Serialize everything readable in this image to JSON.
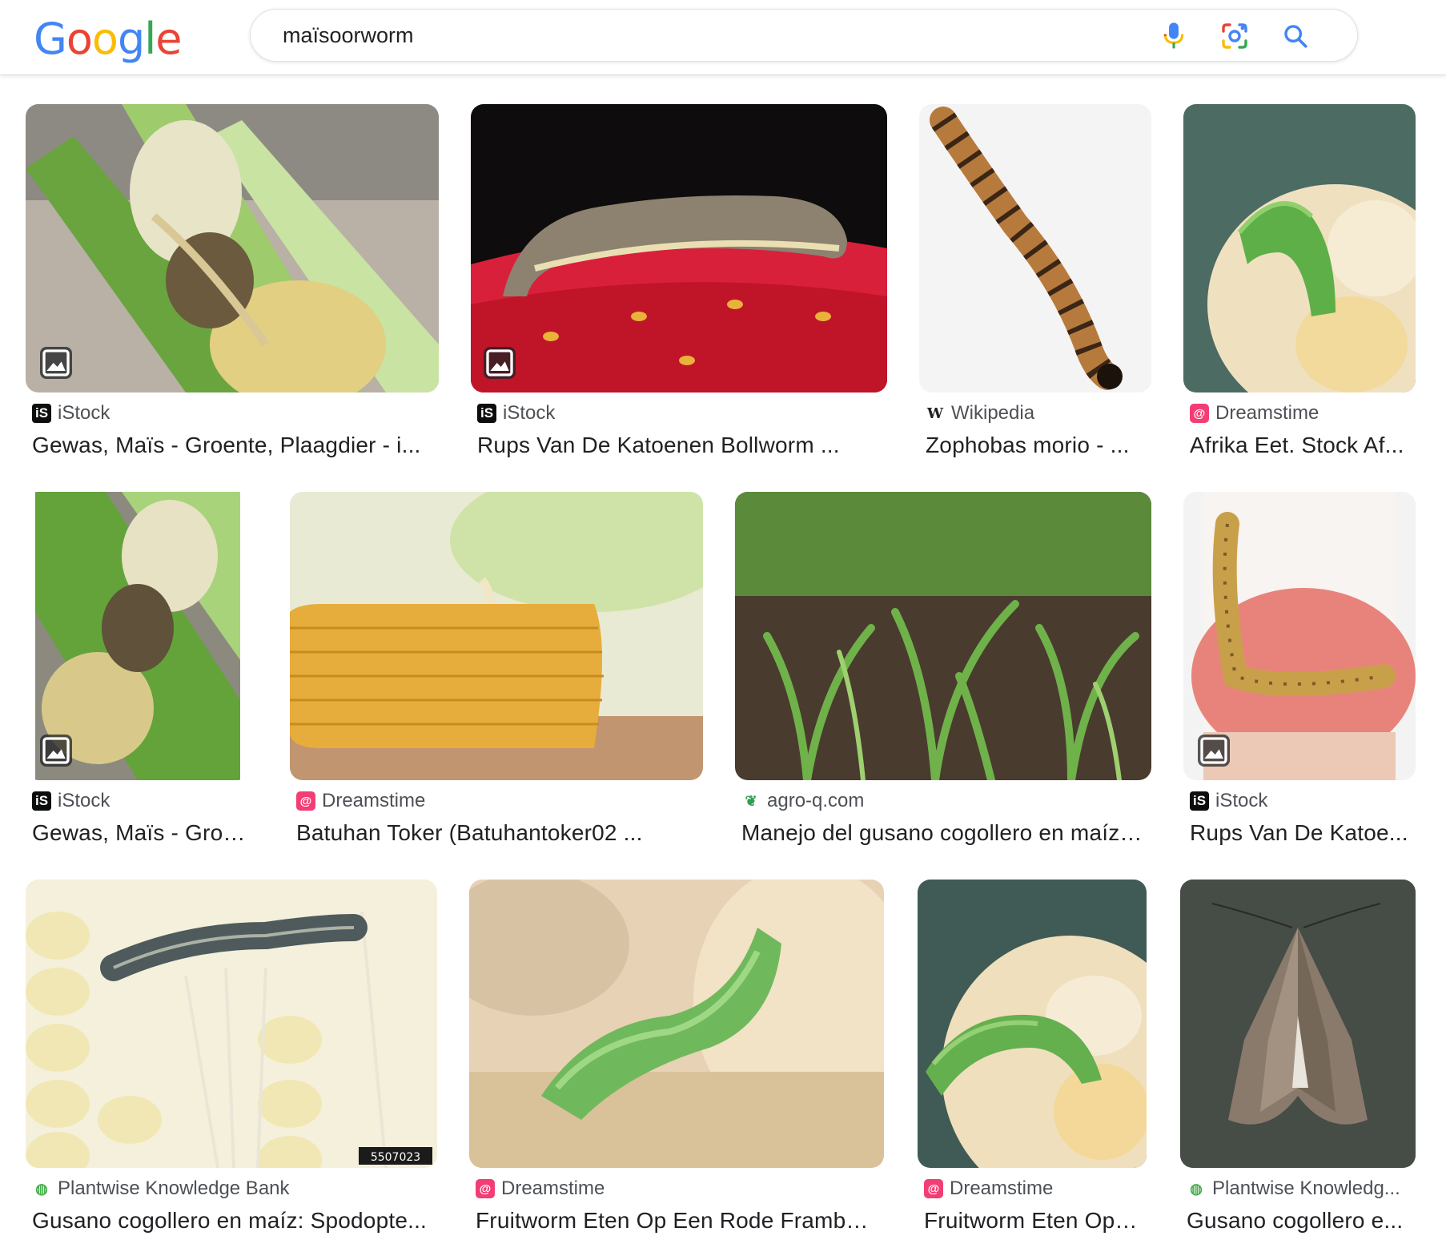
{
  "header": {
    "logo_letters": [
      "G",
      "o",
      "o",
      "g",
      "l",
      "e"
    ],
    "query": "maïsoorworm"
  },
  "colors": {
    "google_blue": "#4285F4",
    "google_red": "#EA4335",
    "google_yellow": "#FBBC05",
    "google_green": "#34A853"
  },
  "results": [
    {
      "source": "iStock",
      "title": "Gewas, Maïs - Groente, Plaagdier - i...",
      "favicon": "istock-favicon"
    },
    {
      "source": "iStock",
      "title": "Rups Van De Katoenen Bollworm ...",
      "favicon": "istock-favicon"
    },
    {
      "source": "Wikipedia",
      "title": "Zophobas morio - ...",
      "favicon": "wikipedia-favicon"
    },
    {
      "source": "Dreamstime",
      "title": "Afrika Eet. Stock Af...",
      "favicon": "dreamstime-favicon"
    },
    {
      "source": "iStock",
      "title": "Gewas, Maïs - Groe...",
      "favicon": "istock-favicon"
    },
    {
      "source": "Dreamstime",
      "title": "Batuhan Toker (Batuhantoker02 ...",
      "favicon": "dreamstime-favicon"
    },
    {
      "source": "agro-q.com",
      "title": "Manejo del gusano cogollero en maíz ...",
      "favicon": "agro-q-favicon"
    },
    {
      "source": "iStock",
      "title": "Rups Van De Katoe...",
      "favicon": "istock-favicon"
    },
    {
      "source": "Plantwise Knowledge Bank",
      "title": "Gusano cogollero en maíz: Spodopte...",
      "favicon": "plantwise-favicon"
    },
    {
      "source": "Dreamstime",
      "title": "Fruitworm Eten Op Een Rode Frambo...",
      "favicon": "dreamstime-favicon"
    },
    {
      "source": "Dreamstime",
      "title": "Fruitworm Eten Op ...",
      "favicon": "dreamstime-favicon"
    },
    {
      "source": "Plantwise Knowledg...",
      "title": "Gusano cogollero e...",
      "favicon": "plantwise-favicon"
    }
  ],
  "image_labels": {
    "r8_stamp": "5507023"
  }
}
